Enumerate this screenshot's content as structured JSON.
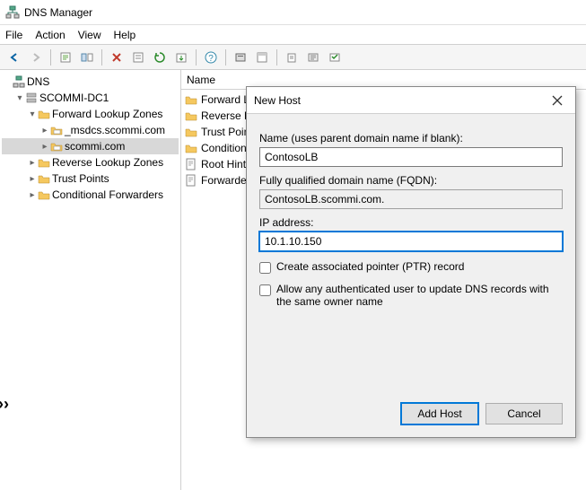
{
  "window": {
    "title": "DNS Manager"
  },
  "menu": {
    "file": "File",
    "action": "Action",
    "view": "View",
    "help": "Help"
  },
  "tree": {
    "root": "DNS",
    "server": "SCOMMI-DC1",
    "flz": "Forward Lookup Zones",
    "msdcs": "_msdcs.scommi.com",
    "scommi": "scommi.com",
    "rlz": "Reverse Lookup Zones",
    "tp": "Trust Points",
    "cf": "Conditional Forwarders"
  },
  "list": {
    "header": "Name",
    "items": [
      "Forward L",
      "Reverse L",
      "Trust Poin",
      "Condition",
      "Root Hint",
      "Forwarder"
    ]
  },
  "dialog": {
    "title": "New Host",
    "name_label": "Name (uses parent domain name if blank):",
    "name_value": "ContosoLB",
    "fqdn_label": "Fully qualified domain name (FQDN):",
    "fqdn_value": "ContosoLB.scommi.com.",
    "ip_label": "IP address:",
    "ip_value": "10.1.10.150",
    "chk_ptr": "Create associated pointer (PTR) record",
    "chk_auth": "Allow any authenticated user to update DNS records with the same owner name",
    "btn_add": "Add Host",
    "btn_cancel": "Cancel"
  }
}
